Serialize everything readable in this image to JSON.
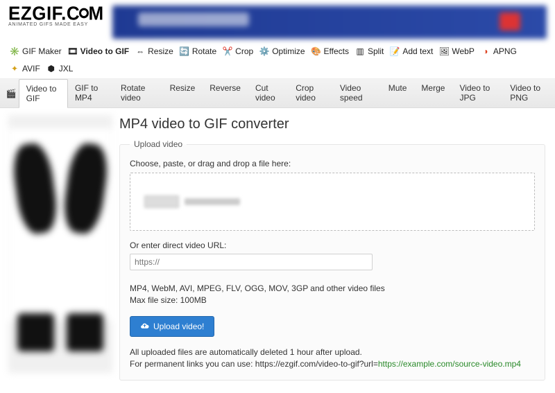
{
  "logo": {
    "line1": "EZGIF.COM",
    "tagline": "ANIMATED GIFS MADE EASY"
  },
  "nav": [
    {
      "icon": "✳️",
      "label": "GIF Maker",
      "active": false
    },
    {
      "icon": "🎞",
      "label": "Video to GIF",
      "active": true
    },
    {
      "icon": "⇔",
      "label": "Resize",
      "active": false
    },
    {
      "icon": "🔄",
      "label": "Rotate",
      "active": false
    },
    {
      "icon": "✂️",
      "label": "Crop",
      "active": false
    },
    {
      "icon": "⚙️",
      "label": "Optimize",
      "active": false
    },
    {
      "icon": "🎨",
      "label": "Effects",
      "active": false
    },
    {
      "icon": "▥",
      "label": "Split",
      "active": false
    },
    {
      "icon": "📝",
      "label": "Add text",
      "active": false
    },
    {
      "icon": "🖼",
      "label": "WebP",
      "active": false
    },
    {
      "icon": "◑",
      "label": "APNG",
      "active": false,
      "icon_color": "#d42"
    },
    {
      "icon": "✦",
      "label": "AVIF",
      "active": false,
      "icon_color": "#d4a017"
    },
    {
      "icon": "⬢",
      "label": "JXL",
      "active": false
    }
  ],
  "subnav": [
    {
      "label": "Video to GIF",
      "active": true
    },
    {
      "label": "GIF to MP4"
    },
    {
      "label": "Rotate video"
    },
    {
      "label": "Resize"
    },
    {
      "label": "Reverse"
    },
    {
      "label": "Cut video"
    },
    {
      "label": "Crop video"
    },
    {
      "label": "Video speed"
    },
    {
      "label": "Mute"
    },
    {
      "label": "Merge"
    },
    {
      "label": "Video to JPG"
    },
    {
      "label": "Video to PNG"
    }
  ],
  "page": {
    "title": "MP4 video to GIF converter",
    "fieldset_legend": "Upload video",
    "drop_label": "Choose, paste, or drag and drop a file here:",
    "or_label": "Or enter direct video URL:",
    "url_placeholder": "https://",
    "formats_line1": "MP4, WebM, AVI, MPEG, FLV, OGG, MOV, 3GP and other video files",
    "formats_line2": "Max file size: 100MB",
    "upload_btn": "Upload video!",
    "note1": "All uploaded files are automatically deleted 1 hour after upload.",
    "note2_prefix": "For permanent links you can use: ",
    "note2_url": "https://ezgif.com/video-to-gif?url=",
    "note2_example": "https://example.com/source-video.mp4"
  }
}
